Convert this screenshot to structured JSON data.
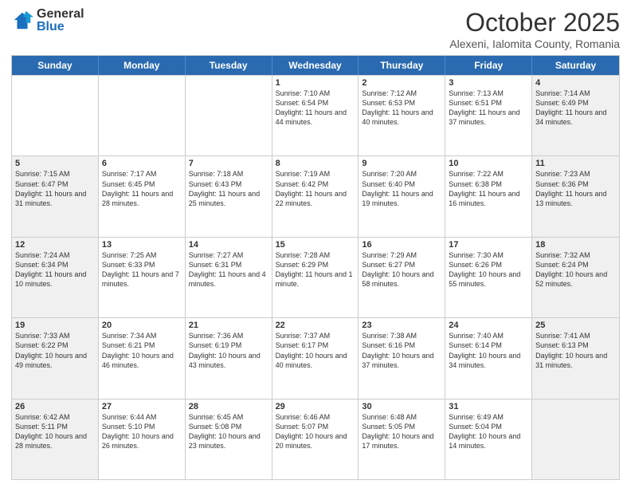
{
  "logo": {
    "general": "General",
    "blue": "Blue"
  },
  "header": {
    "month": "October 2025",
    "location": "Alexeni, Ialomita County, Romania"
  },
  "weekdays": [
    "Sunday",
    "Monday",
    "Tuesday",
    "Wednesday",
    "Thursday",
    "Friday",
    "Saturday"
  ],
  "rows": [
    [
      {
        "day": "",
        "info": "",
        "shaded": false
      },
      {
        "day": "",
        "info": "",
        "shaded": false
      },
      {
        "day": "",
        "info": "",
        "shaded": false
      },
      {
        "day": "1",
        "info": "Sunrise: 7:10 AM\nSunset: 6:54 PM\nDaylight: 11 hours and 44 minutes.",
        "shaded": false
      },
      {
        "day": "2",
        "info": "Sunrise: 7:12 AM\nSunset: 6:53 PM\nDaylight: 11 hours and 40 minutes.",
        "shaded": false
      },
      {
        "day": "3",
        "info": "Sunrise: 7:13 AM\nSunset: 6:51 PM\nDaylight: 11 hours and 37 minutes.",
        "shaded": false
      },
      {
        "day": "4",
        "info": "Sunrise: 7:14 AM\nSunset: 6:49 PM\nDaylight: 11 hours and 34 minutes.",
        "shaded": true
      }
    ],
    [
      {
        "day": "5",
        "info": "Sunrise: 7:15 AM\nSunset: 6:47 PM\nDaylight: 11 hours and 31 minutes.",
        "shaded": true
      },
      {
        "day": "6",
        "info": "Sunrise: 7:17 AM\nSunset: 6:45 PM\nDaylight: 11 hours and 28 minutes.",
        "shaded": false
      },
      {
        "day": "7",
        "info": "Sunrise: 7:18 AM\nSunset: 6:43 PM\nDaylight: 11 hours and 25 minutes.",
        "shaded": false
      },
      {
        "day": "8",
        "info": "Sunrise: 7:19 AM\nSunset: 6:42 PM\nDaylight: 11 hours and 22 minutes.",
        "shaded": false
      },
      {
        "day": "9",
        "info": "Sunrise: 7:20 AM\nSunset: 6:40 PM\nDaylight: 11 hours and 19 minutes.",
        "shaded": false
      },
      {
        "day": "10",
        "info": "Sunrise: 7:22 AM\nSunset: 6:38 PM\nDaylight: 11 hours and 16 minutes.",
        "shaded": false
      },
      {
        "day": "11",
        "info": "Sunrise: 7:23 AM\nSunset: 6:36 PM\nDaylight: 11 hours and 13 minutes.",
        "shaded": true
      }
    ],
    [
      {
        "day": "12",
        "info": "Sunrise: 7:24 AM\nSunset: 6:34 PM\nDaylight: 11 hours and 10 minutes.",
        "shaded": true
      },
      {
        "day": "13",
        "info": "Sunrise: 7:25 AM\nSunset: 6:33 PM\nDaylight: 11 hours and 7 minutes.",
        "shaded": false
      },
      {
        "day": "14",
        "info": "Sunrise: 7:27 AM\nSunset: 6:31 PM\nDaylight: 11 hours and 4 minutes.",
        "shaded": false
      },
      {
        "day": "15",
        "info": "Sunrise: 7:28 AM\nSunset: 6:29 PM\nDaylight: 11 hours and 1 minute.",
        "shaded": false
      },
      {
        "day": "16",
        "info": "Sunrise: 7:29 AM\nSunset: 6:27 PM\nDaylight: 10 hours and 58 minutes.",
        "shaded": false
      },
      {
        "day": "17",
        "info": "Sunrise: 7:30 AM\nSunset: 6:26 PM\nDaylight: 10 hours and 55 minutes.",
        "shaded": false
      },
      {
        "day": "18",
        "info": "Sunrise: 7:32 AM\nSunset: 6:24 PM\nDaylight: 10 hours and 52 minutes.",
        "shaded": true
      }
    ],
    [
      {
        "day": "19",
        "info": "Sunrise: 7:33 AM\nSunset: 6:22 PM\nDaylight: 10 hours and 49 minutes.",
        "shaded": true
      },
      {
        "day": "20",
        "info": "Sunrise: 7:34 AM\nSunset: 6:21 PM\nDaylight: 10 hours and 46 minutes.",
        "shaded": false
      },
      {
        "day": "21",
        "info": "Sunrise: 7:36 AM\nSunset: 6:19 PM\nDaylight: 10 hours and 43 minutes.",
        "shaded": false
      },
      {
        "day": "22",
        "info": "Sunrise: 7:37 AM\nSunset: 6:17 PM\nDaylight: 10 hours and 40 minutes.",
        "shaded": false
      },
      {
        "day": "23",
        "info": "Sunrise: 7:38 AM\nSunset: 6:16 PM\nDaylight: 10 hours and 37 minutes.",
        "shaded": false
      },
      {
        "day": "24",
        "info": "Sunrise: 7:40 AM\nSunset: 6:14 PM\nDaylight: 10 hours and 34 minutes.",
        "shaded": false
      },
      {
        "day": "25",
        "info": "Sunrise: 7:41 AM\nSunset: 6:13 PM\nDaylight: 10 hours and 31 minutes.",
        "shaded": true
      }
    ],
    [
      {
        "day": "26",
        "info": "Sunrise: 6:42 AM\nSunset: 5:11 PM\nDaylight: 10 hours and 28 minutes.",
        "shaded": true
      },
      {
        "day": "27",
        "info": "Sunrise: 6:44 AM\nSunset: 5:10 PM\nDaylight: 10 hours and 26 minutes.",
        "shaded": false
      },
      {
        "day": "28",
        "info": "Sunrise: 6:45 AM\nSunset: 5:08 PM\nDaylight: 10 hours and 23 minutes.",
        "shaded": false
      },
      {
        "day": "29",
        "info": "Sunrise: 6:46 AM\nSunset: 5:07 PM\nDaylight: 10 hours and 20 minutes.",
        "shaded": false
      },
      {
        "day": "30",
        "info": "Sunrise: 6:48 AM\nSunset: 5:05 PM\nDaylight: 10 hours and 17 minutes.",
        "shaded": false
      },
      {
        "day": "31",
        "info": "Sunrise: 6:49 AM\nSunset: 5:04 PM\nDaylight: 10 hours and 14 minutes.",
        "shaded": false
      },
      {
        "day": "",
        "info": "",
        "shaded": true
      }
    ]
  ]
}
